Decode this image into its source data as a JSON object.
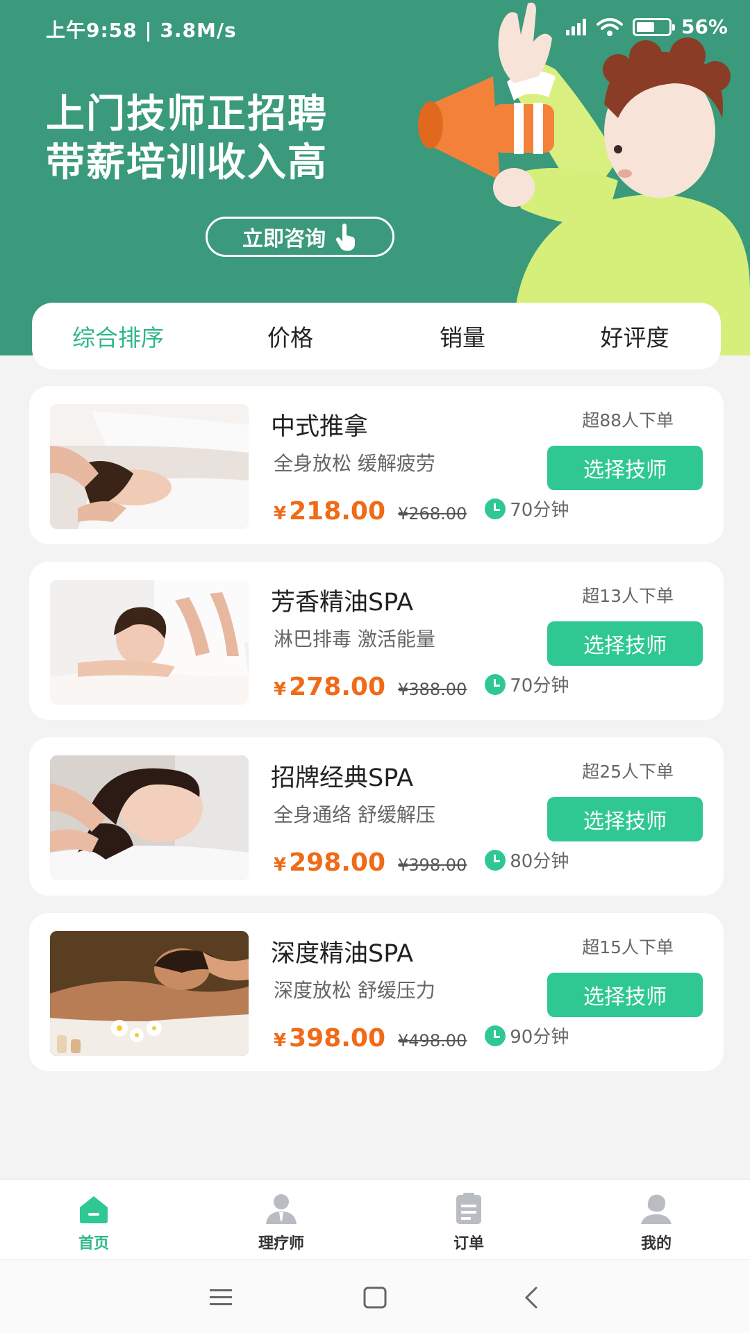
{
  "status_bar": {
    "time_speed": "上午9:58 | 3.8M/s",
    "battery": "56%",
    "battery_level": 0.56
  },
  "banner": {
    "title_line1": "上门技师正招聘",
    "title_line2": "带薪培训收入高",
    "consult_button": "立即咨询"
  },
  "sort_tabs": [
    {
      "label": "综合排序",
      "active": true
    },
    {
      "label": "价格",
      "active": false
    },
    {
      "label": "销量",
      "active": false
    },
    {
      "label": "好评度",
      "active": false
    }
  ],
  "services": [
    {
      "title": "中式推拿",
      "subtitle": "全身放松 缓解疲劳",
      "sold": "超88人下单",
      "currency": "¥",
      "price": "218.00",
      "original_price": "¥268.00",
      "duration": "70分钟",
      "button": "选择技师"
    },
    {
      "title": "芳香精油SPA",
      "subtitle": "淋巴排毒 激活能量",
      "sold": "超13人下单",
      "currency": "¥",
      "price": "278.00",
      "original_price": "¥388.00",
      "duration": "70分钟",
      "button": "选择技师"
    },
    {
      "title": "招牌经典SPA",
      "subtitle": "全身通络 舒缓解压",
      "sold": "超25人下单",
      "currency": "¥",
      "price": "298.00",
      "original_price": "¥398.00",
      "duration": "80分钟",
      "button": "选择技师"
    },
    {
      "title": "深度精油SPA",
      "subtitle": "深度放松 舒缓压力",
      "sold": "超15人下单",
      "currency": "¥",
      "price": "398.00",
      "original_price": "¥498.00",
      "duration": "90分钟",
      "button": "选择技师"
    }
  ],
  "bottom_nav": [
    {
      "label": "首页",
      "icon": "home-icon",
      "active": true
    },
    {
      "label": "理疗师",
      "icon": "therapist-icon",
      "active": false
    },
    {
      "label": "订单",
      "icon": "order-icon",
      "active": false
    },
    {
      "label": "我的",
      "icon": "profile-icon",
      "active": false
    }
  ],
  "colors": {
    "banner_bg": "#3a9a7b",
    "accent_green": "#2fc892",
    "active_tab": "#2fb88c",
    "price_orange": "#f06a17"
  }
}
